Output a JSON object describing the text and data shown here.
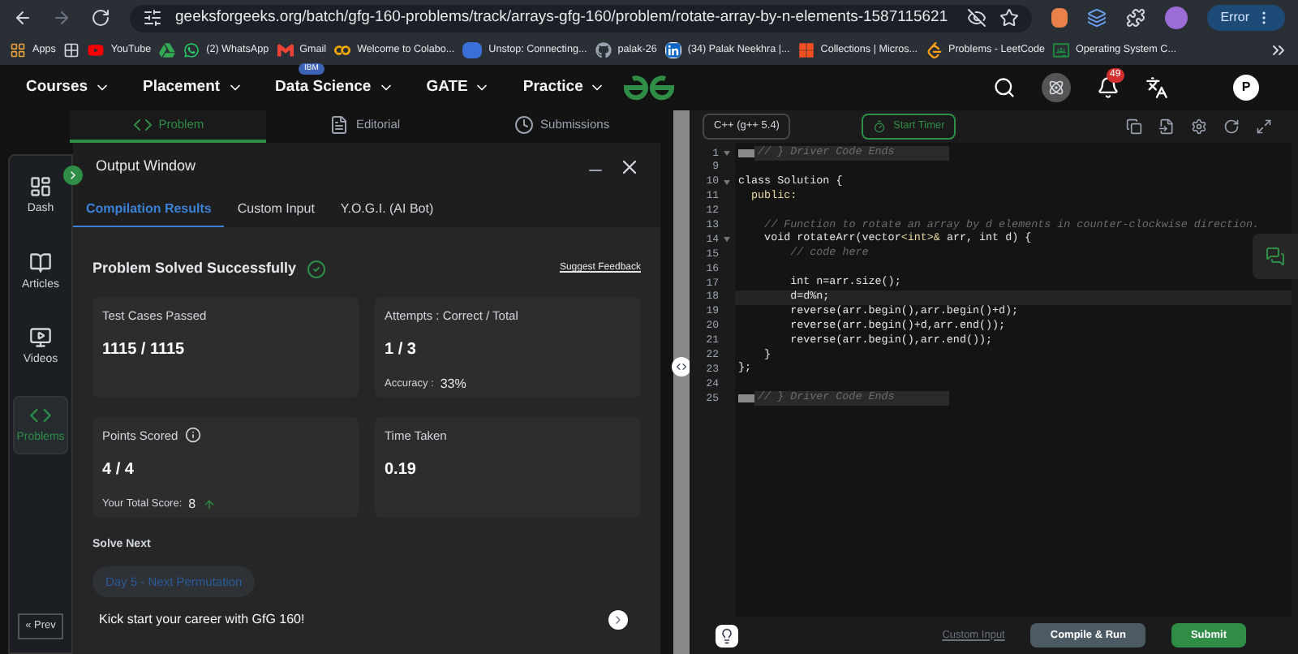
{
  "browser": {
    "url": "geeksforgeeks.org/batch/gfg-160-problems/track/arrays-gfg-160/problem/rotate-array-by-n-elements-1587115621",
    "profile_label": "Error"
  },
  "bookmarks": [
    {
      "kind": "apps",
      "label": "Apps"
    },
    {
      "kind": "grid"
    },
    {
      "kind": "youtube",
      "label": "YouTube"
    },
    {
      "kind": "drive"
    },
    {
      "kind": "whatsapp",
      "label": "(2) WhatsApp"
    },
    {
      "kind": "gmail",
      "label": "Gmail"
    },
    {
      "kind": "colab",
      "label": "Welcome to Colabo..."
    },
    {
      "kind": "unstop",
      "label": "Unstop: Connecting..."
    },
    {
      "kind": "github",
      "label": "palak-26"
    },
    {
      "kind": "linkedin",
      "label": "(34) Palak Neekhra |..."
    },
    {
      "kind": "microsoft",
      "label": "Collections | Micros..."
    },
    {
      "kind": "leetcode",
      "label": "Problems - LeetCode"
    },
    {
      "kind": "classroom",
      "label": "Operating System C..."
    }
  ],
  "site_nav": {
    "menus": [
      {
        "label": "Courses"
      },
      {
        "label": "Placement"
      },
      {
        "label": "Data Science",
        "badge": "IBM"
      },
      {
        "label": "GATE"
      },
      {
        "label": "Practice"
      }
    ],
    "notification_count": "49",
    "avatar": "P"
  },
  "problem_tabs": [
    {
      "kind": "code",
      "label": "Problem",
      "selected": true
    },
    {
      "kind": "doc",
      "label": "Editorial",
      "selected": false
    },
    {
      "kind": "clock",
      "label": "Submissions",
      "selected": false
    }
  ],
  "sidebar": {
    "items": [
      {
        "kind": "dash",
        "label": "Dash",
        "selected": false
      },
      {
        "kind": "articles",
        "label": "Articles",
        "selected": false
      },
      {
        "kind": "videos",
        "label": "Videos",
        "selected": false
      },
      {
        "kind": "problems",
        "label": "Problems",
        "selected": true
      }
    ],
    "prev_button": "« Prev"
  },
  "output_window": {
    "title": "Output Window",
    "tabs": [
      {
        "label": "Compilation Results",
        "selected": true
      },
      {
        "label": "Custom Input",
        "selected": false
      },
      {
        "label": "Y.O.G.I. (AI Bot)",
        "selected": false
      }
    ],
    "status": "Problem Solved Successfully",
    "feedback_link": "Suggest Feedback",
    "cards": [
      {
        "label": "Test Cases Passed",
        "value": "1115 / 1115",
        "info": false
      },
      {
        "label": "Attempts : Correct / Total",
        "value": "1 / 3",
        "info": false,
        "note_label": "Accuracy :",
        "note_value": "33%",
        "trend_up": false
      },
      {
        "label": "Points Scored",
        "value": "4 / 4",
        "info": true,
        "note_label": "Your Total Score:",
        "note_value": "8",
        "trend_up": true
      },
      {
        "label": "Time Taken",
        "value": "0.19",
        "info": false
      }
    ],
    "solve_next_heading": "Solve Next",
    "next_problem": "Day 5 - Next Permutation",
    "promo": "Kick start your career with GfG 160!"
  },
  "editor": {
    "language": "C++ (g++ 5.4)",
    "timer": "Start Timer",
    "lines": [
      {
        "number": "1",
        "foldable": true,
        "collapsed": true,
        "current": false,
        "segments": [
          {
            "kind": "comment",
            "text": "// } Driver Code Ends"
          }
        ]
      },
      {
        "number": "9",
        "foldable": false,
        "collapsed": false,
        "current": false
      },
      {
        "number": "10",
        "foldable": true,
        "collapsed": false,
        "current": false,
        "segments": [
          {
            "kind": "plain",
            "text": "class Solution {"
          }
        ]
      },
      {
        "number": "11",
        "foldable": false,
        "collapsed": false,
        "current": false,
        "segments": [
          {
            "kind": "keyword",
            "text": "  public:"
          }
        ]
      },
      {
        "number": "12",
        "foldable": false,
        "collapsed": false,
        "current": false
      },
      {
        "number": "13",
        "foldable": false,
        "collapsed": false,
        "current": false,
        "segments": [
          {
            "kind": "comment",
            "text": "    // Function to rotate an array by d elements in counter-clockwise direction."
          }
        ]
      },
      {
        "number": "14",
        "foldable": true,
        "collapsed": false,
        "current": false,
        "segments": [
          {
            "kind": "plain",
            "text": "    void rotateArr(vector"
          },
          {
            "kind": "keyword",
            "text": "<int>&"
          },
          {
            "kind": "plain",
            "text": " arr, int d) {"
          }
        ]
      },
      {
        "number": "15",
        "foldable": false,
        "collapsed": false,
        "current": false,
        "segments": [
          {
            "kind": "comment",
            "text": "        // code here"
          }
        ]
      },
      {
        "number": "16",
        "foldable": false,
        "collapsed": false,
        "current": false
      },
      {
        "number": "17",
        "foldable": false,
        "collapsed": false,
        "current": false,
        "segments": [
          {
            "kind": "plain",
            "text": "        int n=arr.size();"
          }
        ]
      },
      {
        "number": "18",
        "foldable": false,
        "collapsed": false,
        "current": true,
        "segments": [
          {
            "kind": "plain",
            "text": "        d=d%n;"
          }
        ]
      },
      {
        "number": "19",
        "foldable": false,
        "collapsed": false,
        "current": false,
        "segments": [
          {
            "kind": "plain",
            "text": "        reverse(arr.begin(),arr.begin()+d);"
          }
        ]
      },
      {
        "number": "20",
        "foldable": false,
        "collapsed": false,
        "current": false,
        "segments": [
          {
            "kind": "plain",
            "text": "        reverse(arr.begin()+d,arr.end());"
          }
        ]
      },
      {
        "number": "21",
        "foldable": false,
        "collapsed": false,
        "current": false,
        "segments": [
          {
            "kind": "plain",
            "text": "        reverse(arr.begin(),arr.end());"
          }
        ]
      },
      {
        "number": "22",
        "foldable": false,
        "collapsed": false,
        "current": false,
        "segments": [
          {
            "kind": "plain",
            "text": "    }"
          }
        ]
      },
      {
        "number": "23",
        "foldable": false,
        "collapsed": false,
        "current": false,
        "segments": [
          {
            "kind": "plain",
            "text": "};"
          }
        ]
      },
      {
        "number": "24",
        "foldable": false,
        "collapsed": false,
        "current": false
      },
      {
        "number": "25",
        "foldable": false,
        "collapsed": true,
        "current": false,
        "segments": [
          {
            "kind": "comment",
            "text": "// } Driver Code Ends"
          }
        ]
      }
    ],
    "custom_input_link": "Custom Input",
    "compile_button": "Compile & Run",
    "submit_button": "Submit"
  }
}
